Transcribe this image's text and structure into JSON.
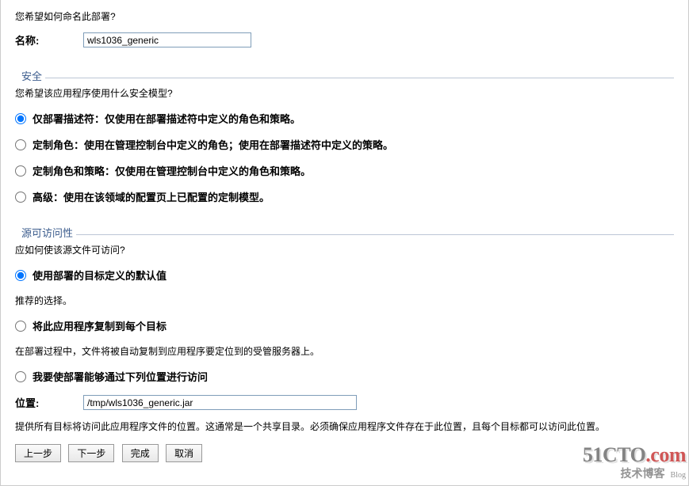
{
  "naming": {
    "question": "您希望如何命名此部署?",
    "label": "名称:",
    "value": "wls1036_generic"
  },
  "security": {
    "header": "安全",
    "question": "您希望该应用程序使用什么安全模型?",
    "options": [
      "仅部署描述符：仅使用在部署描述符中定义的角色和策略。",
      "定制角色：使用在管理控制台中定义的角色；使用在部署描述符中定义的策略。",
      "定制角色和策略：仅使用在管理控制台中定义的角色和策略。",
      "高级：使用在该领域的配置页上已配置的定制模型。"
    ],
    "selected": 0
  },
  "accessibility": {
    "header": "源可访问性",
    "question": "应如何使该源文件可访问?",
    "opt_default": "使用部署的目标定义的默认值",
    "desc_default": "推荐的选择。",
    "opt_copy": "将此应用程序复制到每个目标",
    "desc_copy": "在部署过程中，文件将被自动复制到应用程序要定位到的受管服务器上。",
    "opt_location": "我要使部署能够通过下列位置进行访问",
    "location_label": "位置:",
    "location_value": "/tmp/wls1036_generic.jar",
    "desc_location": "提供所有目标将访问此应用程序文件的位置。这通常是一个共享目录。必须确保应用程序文件存在于此位置，且每个目标都可以访问此位置。",
    "selected": 0
  },
  "buttons": {
    "back": "上一步",
    "next": "下一步",
    "finish": "完成",
    "cancel": "取消"
  },
  "watermark": {
    "brand_pre": "51CTO",
    "brand_suf": ".com",
    "sub": "技术博客",
    "sub2": "Blog"
  }
}
